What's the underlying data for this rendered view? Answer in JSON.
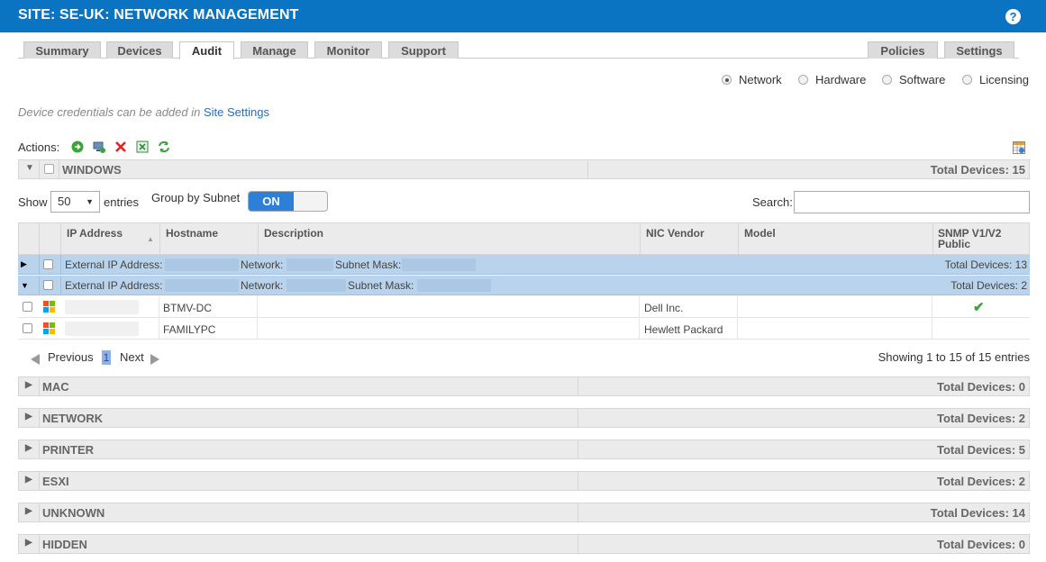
{
  "header": {
    "title": "SITE: SE-UK: NETWORK MANAGEMENT",
    "help_icon": "question-icon",
    "help_label": "?"
  },
  "tabs": [
    {
      "label": "Summary"
    },
    {
      "label": "Devices"
    },
    {
      "label": "Audit",
      "active": true
    },
    {
      "label": "Manage"
    },
    {
      "label": "Monitor"
    },
    {
      "label": "Support"
    },
    {
      "label": "Policies"
    },
    {
      "label": "Settings"
    }
  ],
  "audit_type": {
    "selected": "Network",
    "options": [
      "Network",
      "Hardware",
      "Software",
      "Licensing"
    ]
  },
  "note": {
    "text": "Device credentials can be added in",
    "link": "Site Settings"
  },
  "actions": {
    "label": "Actions:",
    "icons": [
      "go-arrow-icon",
      "add-device-icon",
      "delete-icon",
      "export-excel-icon",
      "refresh-icon"
    ],
    "column_settings_icon": "column-settings-icon"
  },
  "groups": {
    "windows": {
      "name": "WINDOWS",
      "total": "Total Devices: 15",
      "expanded": true
    },
    "collapsed": [
      {
        "name": "MAC",
        "total": "Total Devices: 0"
      },
      {
        "name": "NETWORK",
        "total": "Total Devices: 2"
      },
      {
        "name": "PRINTER",
        "total": "Total Devices: 5"
      },
      {
        "name": "ESXI",
        "total": "Total Devices: 2"
      },
      {
        "name": "UNKNOWN",
        "total": "Total Devices: 14"
      },
      {
        "name": "HIDDEN",
        "total": "Total Devices: 0"
      }
    ]
  },
  "table_controls": {
    "show_label": "Show",
    "page_size": "50",
    "entries_label": "entries",
    "group_by_label": "Group by Subnet",
    "group_by_toggle": "ON",
    "search_label": "Search:",
    "search_value": ""
  },
  "columns": [
    "IP Address",
    "Hostname",
    "Description",
    "NIC Vendor",
    "Model",
    "SNMP V1/V2 Public"
  ],
  "subnets": [
    {
      "ext_label": "External IP Address:",
      "network_label": "Network:",
      "mask_label": "Subnet Mask:",
      "total": "Total Devices: 13",
      "expanded": false
    },
    {
      "ext_label": "External IP Address:",
      "network_label": "Network:",
      "mask_label": "Subnet Mask:",
      "total": "Total Devices: 2",
      "expanded": true
    }
  ],
  "rows": [
    {
      "hostname": "BTMV-DC",
      "description": "",
      "nic_vendor": "Dell Inc.",
      "model": "",
      "snmp": "✔"
    },
    {
      "hostname": "FAMILYPC",
      "description": "",
      "nic_vendor": "Hewlett Packard",
      "model": "",
      "snmp": ""
    }
  ],
  "pagination": {
    "previous": "Previous",
    "page": "1",
    "next": "Next",
    "summary": "Showing 1 to 15 of 15 entries"
  },
  "colors": {
    "header_bg": "#0a73c2",
    "toggle_on": "#2d7fd8",
    "subnet_row": "#b9d3ec",
    "check_green": "#3aa33a"
  }
}
